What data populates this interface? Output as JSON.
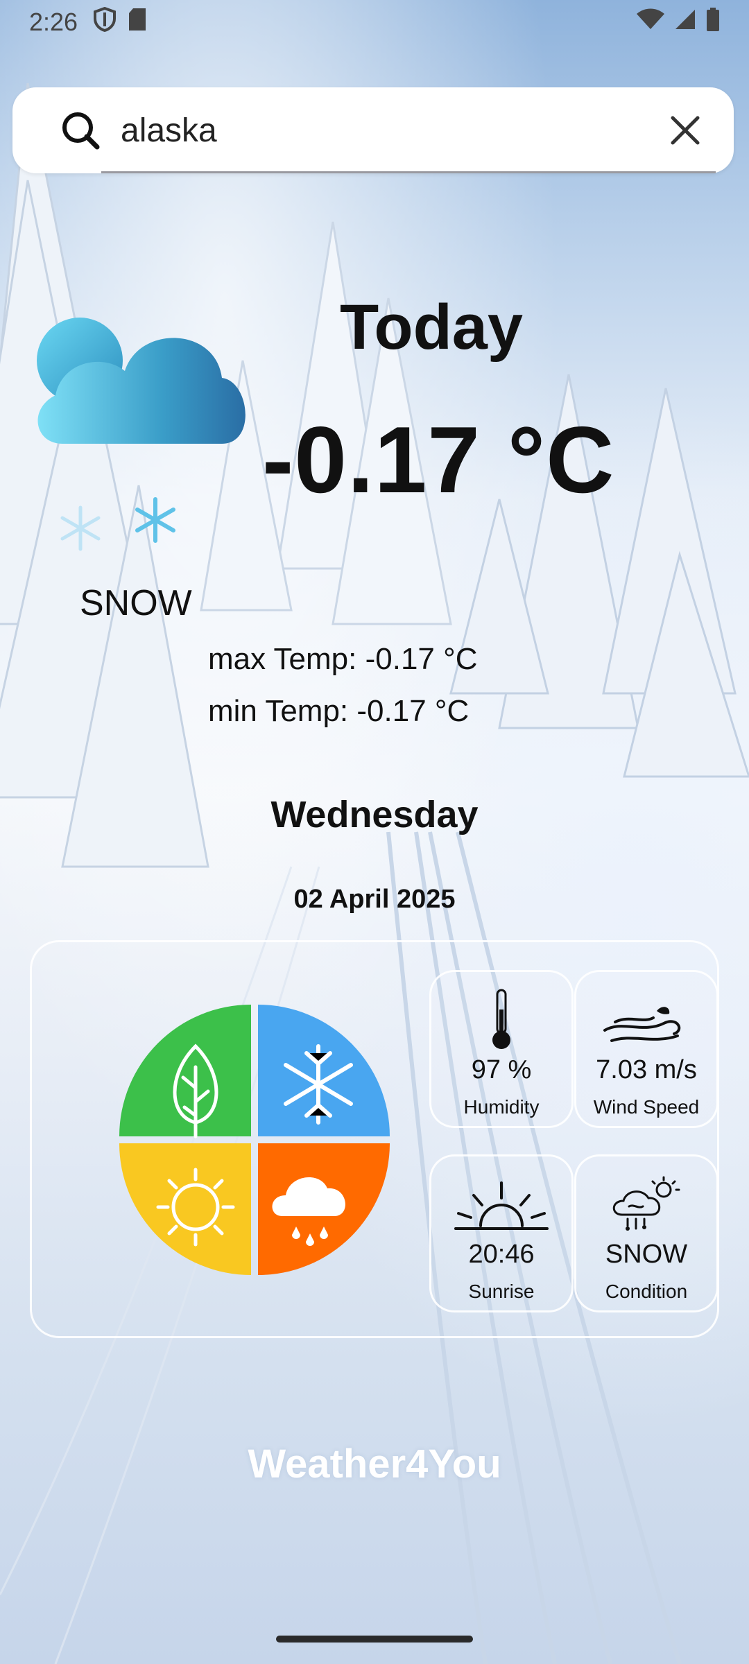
{
  "status_bar": {
    "time": "2:26"
  },
  "search": {
    "value": "alaska",
    "placeholder": ""
  },
  "weather": {
    "heading": "Today",
    "temperature": "-0.17 °C",
    "condition": "SNOW",
    "max_temp": "max Temp: -0.17 °C",
    "min_temp": "min Temp: -0.17 °C",
    "weekday": "Wednesday",
    "date": "02 April 2025"
  },
  "stats": {
    "humidity": {
      "value": "97 %",
      "label": "Humidity"
    },
    "wind": {
      "value": "7.03 m/s",
      "label": "Wind Speed"
    },
    "sunrise": {
      "value": "20:46",
      "label": "Sunrise"
    },
    "condition": {
      "value": "SNOW",
      "label": "Condition"
    }
  },
  "brand": "Weather4You",
  "colors": {
    "season_green": "#3cc04a",
    "season_blue": "#49a6f0",
    "season_yellow": "#f9c821",
    "season_orange": "#ff6a00"
  },
  "icons": [
    "search-icon",
    "close-icon",
    "cloud-icon",
    "snowflake-icon",
    "thermometer-icon",
    "wind-icon",
    "sunrise-icon",
    "storm-icon",
    "seasons-pie-icon"
  ]
}
